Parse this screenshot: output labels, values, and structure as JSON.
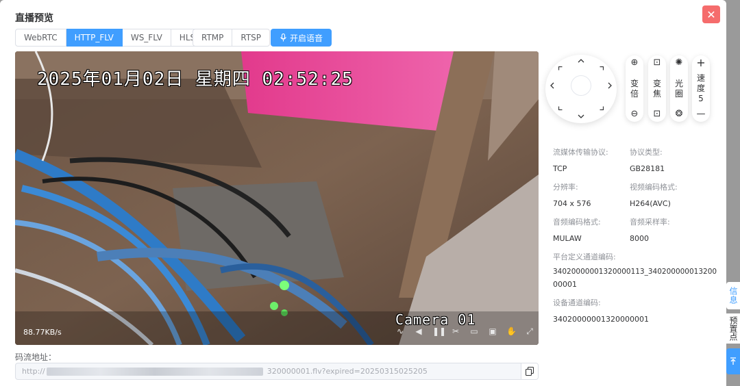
{
  "dialog": {
    "title": "直播预览",
    "close_label": "✕"
  },
  "player_types": [
    {
      "label": "WebRTC",
      "active": false
    },
    {
      "label": "HTTP_FLV",
      "active": true
    },
    {
      "label": "WS_FLV",
      "active": false
    },
    {
      "label": "HLS",
      "active": false
    }
  ],
  "push_types": [
    {
      "label": "RTMP",
      "active": false
    },
    {
      "label": "RTSP",
      "active": false
    }
  ],
  "voice_button": {
    "label": "开启语音",
    "icon": "microphone-icon"
  },
  "video": {
    "osd_datetime": "2025年01月02日  星期四  02:52:25",
    "osd_camera": "Camera 01",
    "bitrate": "88.77KB/s",
    "controls": [
      "waveform-icon",
      "volume-icon",
      "pause-icon",
      "scissors-icon",
      "fullscreen-corners-icon",
      "record-icon",
      "ai-icon",
      "expand-icon"
    ]
  },
  "stream_url": {
    "label": "码流地址：",
    "prefix": "http://",
    "suffix": "320000001.flv?expired=20250315025205",
    "copy_icon": "copy-icon"
  },
  "ptz": {
    "up": "^",
    "down": "v",
    "left": "<",
    "right": ">"
  },
  "ptz_pills": [
    {
      "name": "zoom",
      "top_icon": "⊕",
      "label_lines": [
        "变",
        "倍"
      ],
      "bottom_icon": "⊖"
    },
    {
      "name": "focus",
      "top_icon": "⊡",
      "label_lines": [
        "变",
        "焦"
      ],
      "bottom_icon": "⊡"
    },
    {
      "name": "iris",
      "top_icon": "✺",
      "label_lines": [
        "光",
        "圈"
      ],
      "bottom_icon": "❂"
    },
    {
      "name": "speed",
      "top_icon": "+",
      "label_lines": [
        "速",
        "度",
        "5"
      ],
      "bottom_icon": "—"
    }
  ],
  "info": {
    "protocol_label": "流媒体传输协议:",
    "protocol_value": "TCP",
    "protocol_type_label": "协议类型:",
    "protocol_type_value": "GB28181",
    "resolution_label": "分辨率:",
    "resolution_value": "704 x 576",
    "video_codec_label": "视频编码格式:",
    "video_codec_value": "H264(AVC)",
    "audio_codec_label": "音频编码格式:",
    "audio_codec_value": "MULAW",
    "sample_rate_label": "音频采样率:",
    "sample_rate_value": "8000",
    "platform_channel_label": "平台定义通道编码:",
    "platform_channel_value_line1": "34020000001320000113_340200000013200",
    "platform_channel_value_line2": "00001",
    "device_channel_label": "设备通道编码:",
    "device_channel_value": "34020000001320000001"
  },
  "side_tabs": [
    {
      "label": "信息",
      "active": true
    },
    {
      "label": "预置点",
      "active": false
    }
  ],
  "back_to_top_icon": "arrow-up-to-top-icon"
}
